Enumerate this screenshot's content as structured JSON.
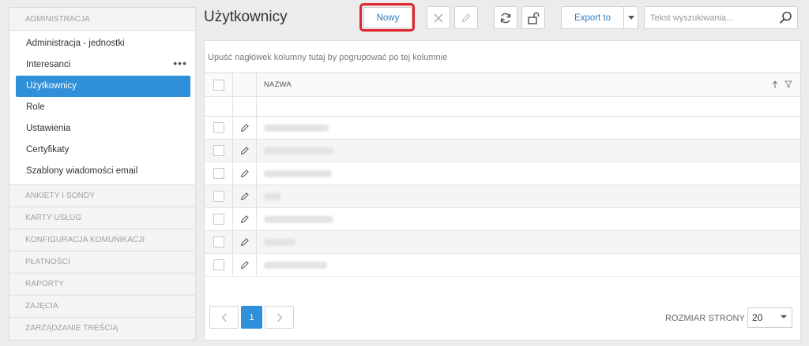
{
  "sidebar": {
    "sections": [
      {
        "title": "ADMINISTRACJA"
      },
      {
        "title": "ANKIETY I SONDY"
      },
      {
        "title": "KARTY USŁUG"
      },
      {
        "title": "KONFIGURACJA KOMUNIKACJI"
      },
      {
        "title": "PŁATNOŚCI"
      },
      {
        "title": "RAPORTY"
      },
      {
        "title": "ZAJĘCIA"
      },
      {
        "title": "ZARZĄDZANIE TREŚCIĄ"
      }
    ],
    "items": [
      {
        "label": "Administracja - jednostki"
      },
      {
        "label": "Interesanci",
        "more": "•••"
      },
      {
        "label": "Użytkownicy"
      },
      {
        "label": "Role"
      },
      {
        "label": "Ustawienia"
      },
      {
        "label": "Certyfikaty"
      },
      {
        "label": "Szablony wiadomości email"
      }
    ]
  },
  "header": {
    "title": "Użytkownicy",
    "new_label": "Nowy",
    "export_label": "Export to",
    "search_placeholder": "Tekst wyszukiwania..."
  },
  "grid": {
    "group_hint": "Upuść nagłówek kolumny tutaj by pogrupować po tej kolumnie",
    "column_name": "NAZWA"
  },
  "pager": {
    "current_page": "1",
    "page_size_label": "ROZMIAR STRONY",
    "page_size": "20"
  },
  "colors": {
    "accent": "#2f8fd8",
    "highlight": "#e0242c"
  }
}
